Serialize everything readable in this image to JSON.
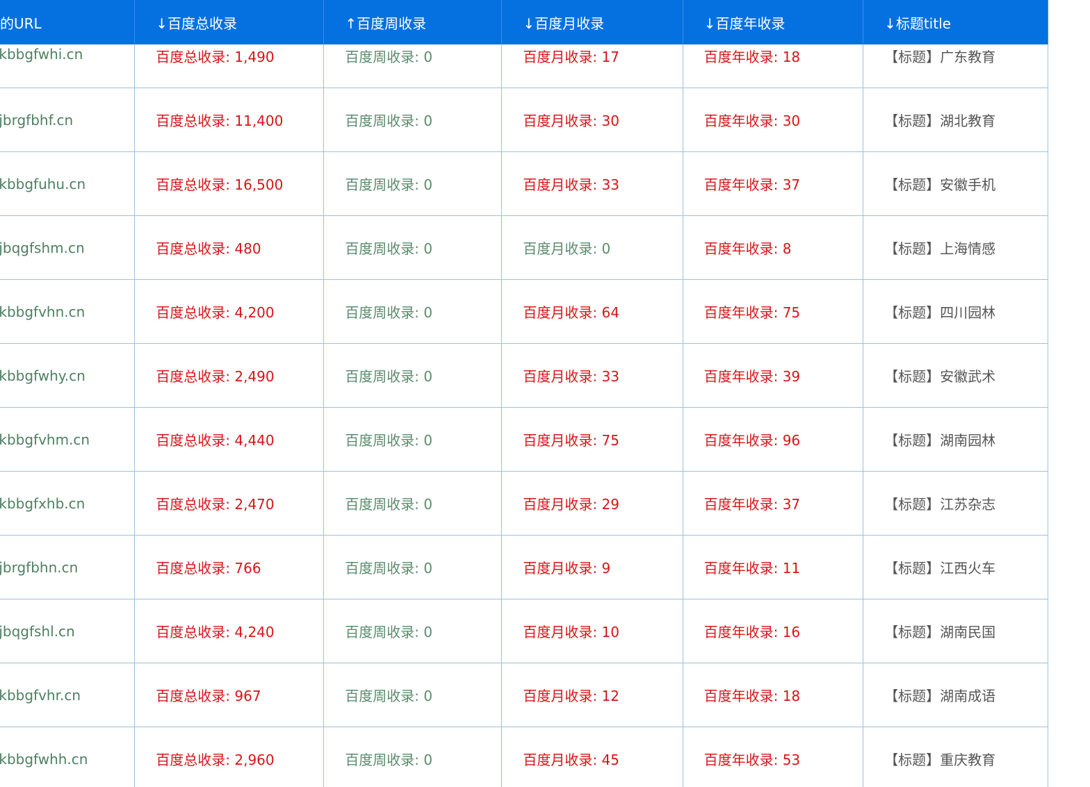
{
  "colors": {
    "header_bg": "#0571e1",
    "header_text": "#ffffff",
    "highlight_value": "#d91418",
    "zero_value": "#5a8b6c",
    "url_text": "#4e7f62",
    "border": "#9cc0df"
  },
  "headers": [
    "的URL",
    "↓百度总收录",
    "↑百度周收录",
    "↓百度月收录",
    "↓百度年收录",
    "↓标题title"
  ],
  "rows": [
    {
      "url": ".kbbgfwhi.cn",
      "total": "百度总收录: 1,490",
      "week": "百度周收录: 0",
      "month": "百度月收录: 17",
      "year": "百度年收录: 18",
      "title": "【标题】广东教育"
    },
    {
      "url": ".jbrgfbhf.cn",
      "total": "百度总收录: 11,400",
      "week": "百度周收录: 0",
      "month": "百度月收录: 30",
      "year": "百度年收录: 30",
      "title": "【标题】湖北教育"
    },
    {
      "url": ".kbbgfuhu.cn",
      "total": "百度总收录: 16,500",
      "week": "百度周收录: 0",
      "month": "百度月收录: 33",
      "year": "百度年收录: 37",
      "title": "【标题】安徽手机"
    },
    {
      "url": ".jbqgfshm.cn",
      "total": "百度总收录: 480",
      "week": "百度周收录: 0",
      "month": "百度月收录: 0",
      "year": "百度年收录: 8",
      "title": "【标题】上海情感"
    },
    {
      "url": ".kbbgfvhn.cn",
      "total": "百度总收录: 4,200",
      "week": "百度周收录: 0",
      "month": "百度月收录: 64",
      "year": "百度年收录: 75",
      "title": "【标题】四川园林"
    },
    {
      "url": ".kbbgfwhy.cn",
      "total": "百度总收录: 2,490",
      "week": "百度周收录: 0",
      "month": "百度月收录: 33",
      "year": "百度年收录: 39",
      "title": "【标题】安徽武术"
    },
    {
      "url": ".kbbgfvhm.cn",
      "total": "百度总收录: 4,440",
      "week": "百度周收录: 0",
      "month": "百度月收录: 75",
      "year": "百度年收录: 96",
      "title": "【标题】湖南园林"
    },
    {
      "url": ".kbbgfxhb.cn",
      "total": "百度总收录: 2,470",
      "week": "百度周收录: 0",
      "month": "百度月收录: 29",
      "year": "百度年收录: 37",
      "title": "【标题】江苏杂志"
    },
    {
      "url": ".jbrgfbhn.cn",
      "total": "百度总收录: 766",
      "week": "百度周收录: 0",
      "month": "百度月收录: 9",
      "year": "百度年收录: 11",
      "title": "【标题】江西火车"
    },
    {
      "url": ".jbqgfshl.cn",
      "total": "百度总收录: 4,240",
      "week": "百度周收录: 0",
      "month": "百度月收录: 10",
      "year": "百度年收录: 16",
      "title": "【标题】湖南民国"
    },
    {
      "url": ".kbbgfvhr.cn",
      "total": "百度总收录: 967",
      "week": "百度周收录: 0",
      "month": "百度月收录: 12",
      "year": "百度年收录: 18",
      "title": "【标题】湖南成语"
    },
    {
      "url": ".kbbgfwhh.cn",
      "total": "百度总收录: 2,960",
      "week": "百度周收录: 0",
      "month": "百度月收录: 45",
      "year": "百度年收录: 53",
      "title": "【标题】重庆教育"
    }
  ]
}
